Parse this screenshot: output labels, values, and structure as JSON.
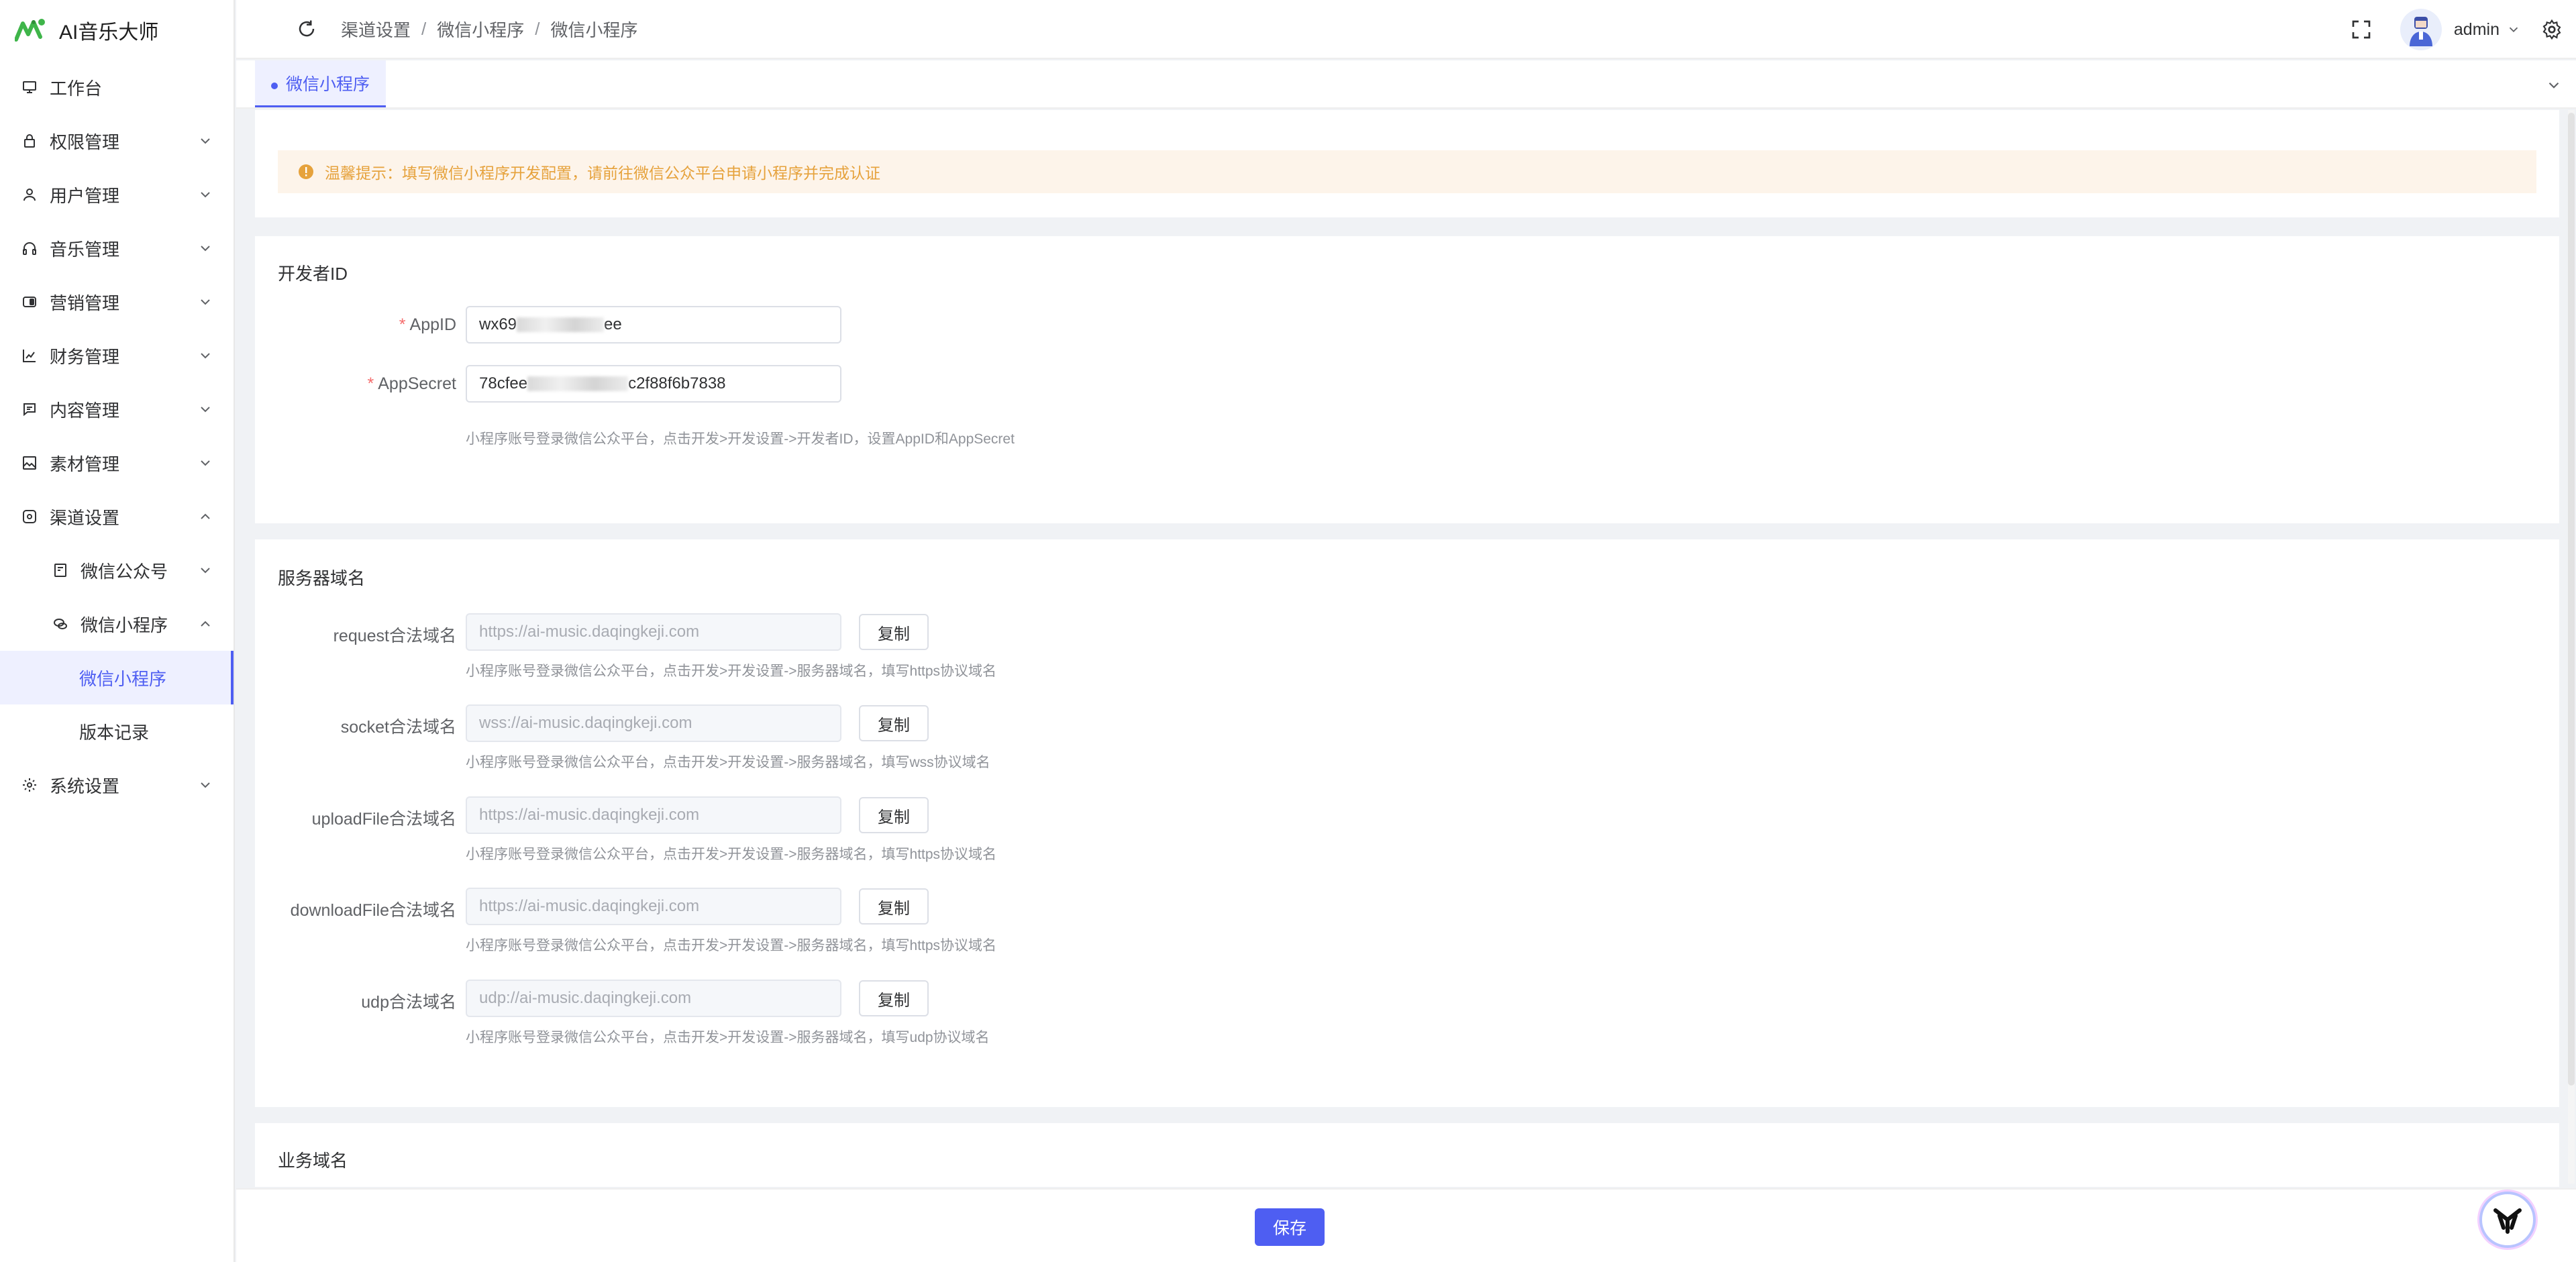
{
  "app": {
    "title": "AI音乐大师"
  },
  "sidebar": {
    "items": [
      {
        "label": "工作台",
        "icon": "monitor-icon"
      },
      {
        "label": "权限管理",
        "icon": "lock-icon"
      },
      {
        "label": "用户管理",
        "icon": "user-icon"
      },
      {
        "label": "音乐管理",
        "icon": "headphones-icon"
      },
      {
        "label": "营销管理",
        "icon": "toggle-icon"
      },
      {
        "label": "财务管理",
        "icon": "bar-chart-icon"
      },
      {
        "label": "内容管理",
        "icon": "message-icon"
      },
      {
        "label": "素材管理",
        "icon": "image-icon"
      },
      {
        "label": "渠道设置",
        "icon": "circle-square-icon"
      },
      {
        "label": "微信公众号",
        "icon": "document-icon"
      },
      {
        "label": "微信小程序",
        "icon": "chat-bubbles-icon"
      },
      {
        "label": "微信小程序"
      },
      {
        "label": "版本记录"
      },
      {
        "label": "系统设置",
        "icon": "gear-icon"
      }
    ]
  },
  "header": {
    "breadcrumb": [
      "渠道设置",
      "微信小程序",
      "微信小程序"
    ],
    "separator": "/",
    "username": "admin"
  },
  "tabs": {
    "active_label": "微信小程序"
  },
  "alert": {
    "text": "温馨提示：填写微信小程序开发配置，请前往微信公众平台申请小程序并完成认证"
  },
  "developer": {
    "title": "开发者ID",
    "appid_label": "AppID",
    "appid_prefix": "wx69",
    "appid_suffix": "ee",
    "secret_label": "AppSecret",
    "secret_prefix": "78cfee",
    "secret_suffix": "c2f88f6b7838",
    "hint": "小程序账号登录微信公众平台，点击开发>开发设置->开发者ID，设置AppID和AppSecret",
    "required_mark": "*"
  },
  "server": {
    "title": "服务器域名",
    "copy_label": "复制",
    "rows": [
      {
        "label": "request合法域名",
        "value": "https://ai-music.daqingkeji.com",
        "hint": "小程序账号登录微信公众平台，点击开发>开发设置->服务器域名，填写https协议域名"
      },
      {
        "label": "socket合法域名",
        "value": "wss://ai-music.daqingkeji.com",
        "hint": "小程序账号登录微信公众平台，点击开发>开发设置->服务器域名，填写wss协议域名"
      },
      {
        "label": "uploadFile合法域名",
        "value": "https://ai-music.daqingkeji.com",
        "hint": "小程序账号登录微信公众平台，点击开发>开发设置->服务器域名，填写https协议域名"
      },
      {
        "label": "downloadFile合法域名",
        "value": "https://ai-music.daqingkeji.com",
        "hint": "小程序账号登录微信公众平台，点击开发>开发设置->服务器域名，填写https协议域名"
      },
      {
        "label": "udp合法域名",
        "value": "udp://ai-music.daqingkeji.com",
        "hint": "小程序账号登录微信公众平台，点击开发>开发设置->服务器域名，填写udp协议域名"
      }
    ]
  },
  "business": {
    "title": "业务域名"
  },
  "footer": {
    "save_label": "保存"
  },
  "colors": {
    "primary": "#4e5ef2",
    "warning": "#e6a23c",
    "required": "#f56c6c"
  }
}
